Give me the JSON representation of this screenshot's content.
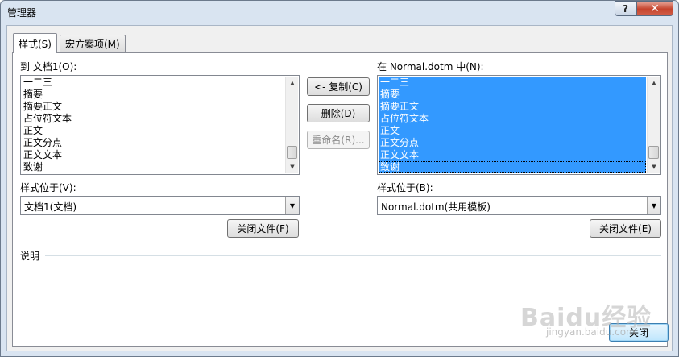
{
  "window": {
    "title": "管理器",
    "help_glyph": "?",
    "close_glyph": "✕"
  },
  "tabs": [
    {
      "label": "样式(S)",
      "active": true
    },
    {
      "label": "宏方案项(M)",
      "active": false
    }
  ],
  "left": {
    "list_label": "到 文档1(O):",
    "items": [
      "一二三",
      "摘要",
      "摘要正文",
      "占位符文本",
      "正文",
      "正文分点",
      "正文文本",
      "致谢"
    ],
    "styles_in_label": "样式位于(V):",
    "styles_in_value": "文档1(文档)",
    "close_file_label": "关闭文件(F)"
  },
  "right": {
    "list_label": "在 Normal.dotm 中(N):",
    "items": [
      "一二三",
      "摘要",
      "摘要正文",
      "占位符文本",
      "正文",
      "正文分点",
      "正文文本",
      "致谢"
    ],
    "styles_in_label": "样式位于(B):",
    "styles_in_value": "Normal.dotm(共用模板)",
    "close_file_label": "关闭文件(E)"
  },
  "middle": {
    "copy_label": "<- 复制(C)",
    "delete_label": "删除(D)",
    "rename_label": "重命名(R)..."
  },
  "description_label": "说明",
  "close_button_label": "关闭",
  "watermark": {
    "main": "Baidu经验",
    "sub": "jingyan.baidu.com"
  },
  "colors": {
    "selection": "#3399ff",
    "frame": "#d9e4f1",
    "close_button": "#c5432c"
  }
}
